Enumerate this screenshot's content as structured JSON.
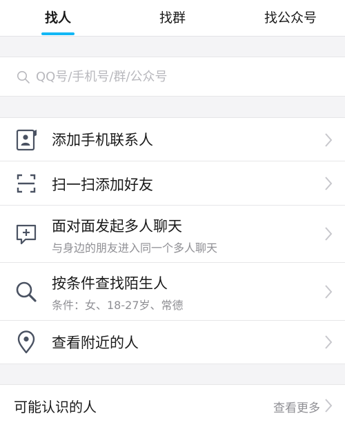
{
  "tabs": [
    {
      "label": "找人",
      "active": true
    },
    {
      "label": "找群",
      "active": false
    },
    {
      "label": "找公众号",
      "active": false
    }
  ],
  "search": {
    "placeholder": "QQ号/手机号/群/公众号"
  },
  "menu": [
    {
      "icon": "contact-card-icon",
      "title": "添加手机联系人"
    },
    {
      "icon": "scan-icon",
      "title": "扫一扫添加好友"
    },
    {
      "icon": "chat-add-icon",
      "title": "面对面发起多人聊天",
      "subtitle": "与身边的朋友进入同一个多人聊天"
    },
    {
      "icon": "magnifier-icon",
      "title": "按条件查找陌生人",
      "subtitle": "条件：女、18-27岁、常德"
    },
    {
      "icon": "location-pin-icon",
      "title": "查看附近的人"
    }
  ],
  "recommend": {
    "title": "可能认识的人",
    "more_label": "查看更多"
  },
  "colors": {
    "accent": "#12b7f5",
    "icon": "#4a5262",
    "secondary_text": "#8f8f94",
    "background": "#f4f4f6"
  }
}
